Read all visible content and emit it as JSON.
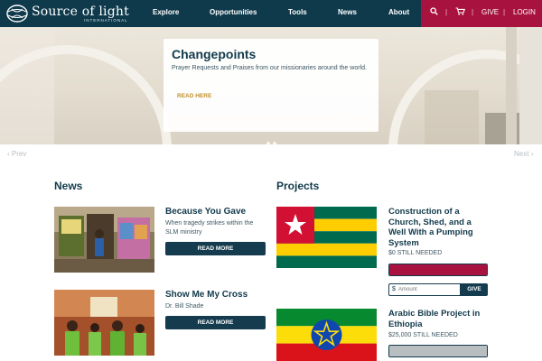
{
  "header": {
    "logo_text": "Source of light",
    "logo_sub": "INTERNATIONAL",
    "nav": [
      "Explore",
      "Opportunities",
      "Tools",
      "News",
      "About"
    ],
    "search_icon": "search-icon",
    "cart_icon": "cart-icon",
    "give_label": "GIVE",
    "login_label": "LOGIN",
    "separator": "|"
  },
  "hero": {
    "title": "Changepoints",
    "body": "Prayer Requests and Praises from our missionaries around the world.",
    "link": "READ HERE",
    "prev": "Prev",
    "next": "Next",
    "slide_count": 2,
    "active_slide": 1
  },
  "news": {
    "title": "News",
    "items": [
      {
        "title": "Because You Gave",
        "subtitle": "When tragedy strikes within the SLM ministry",
        "button": "READ MORE"
      },
      {
        "title": "Show Me My Cross",
        "subtitle": "Dr. Bill Shade",
        "button": "READ MORE"
      }
    ]
  },
  "projects": {
    "title": "Projects",
    "items": [
      {
        "title": "Construction of a Church, Shed, and a Well With a Pumping System",
        "needed": "$0 STILL NEEDED",
        "progress": 1.0,
        "bar_color": "#a8123e"
      },
      {
        "title": "Arabic Bible Project in Ethiopia",
        "needed": "$25,000 STILL NEEDED",
        "progress": 1.0,
        "bar_color": "#b9bec1"
      }
    ],
    "donate": {
      "currency": "$",
      "placeholder": "Amount",
      "button": "GIVE"
    }
  },
  "colors": {
    "header_bg": "#0f3a4c",
    "accent": "#a8123e",
    "link_gold": "#c0902a",
    "button_bg": "#143c4e"
  }
}
